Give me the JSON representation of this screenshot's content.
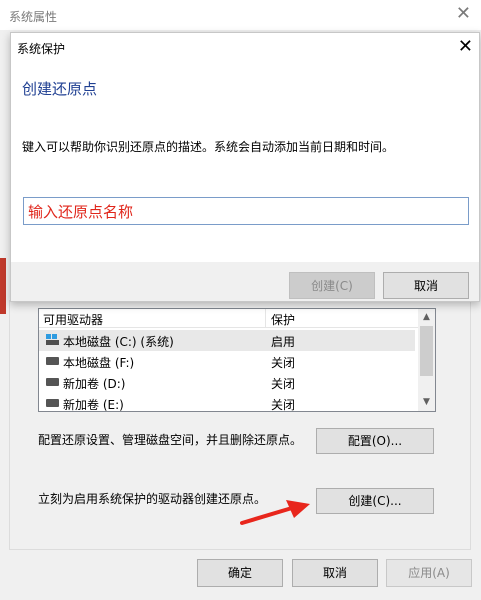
{
  "outer_window": {
    "title": "系统属性",
    "close_symbol": "✕"
  },
  "protection": {
    "columns": [
      "可用驱动器",
      "保护"
    ],
    "drives": [
      {
        "name": "本地磁盘 (C:) (系统)",
        "status": "启用",
        "icon": "system-drive-icon"
      },
      {
        "name": "本地磁盘 (F:)",
        "status": "关闭",
        "icon": "drive-icon"
      },
      {
        "name": "新加卷 (D:)",
        "status": "关闭",
        "icon": "drive-icon"
      },
      {
        "name": "新加卷 (E:)",
        "status": "关闭",
        "icon": "drive-icon"
      }
    ],
    "config_text": "配置还原设置、管理磁盘空间，并且删除还原点。",
    "config_button": "配置(O)...",
    "create_text": "立刻为启用系统保护的驱动器创建还原点。",
    "create_button": "创建(C)..."
  },
  "footer": {
    "ok": "确定",
    "cancel": "取消",
    "apply": "应用(A)"
  },
  "dialog": {
    "title": "系统保护",
    "close_symbol": "✕",
    "heading": "创建还原点",
    "description": "键入可以帮助你识别还原点的描述。系统会自动添加当前日期和时间。",
    "input_value": "输入还原点名称",
    "create_button": "创建(C)",
    "cancel_button": "取消"
  },
  "colors": {
    "heading": "#1f3f92",
    "input_text": "#e0261b",
    "arrow": "#e8261c"
  }
}
